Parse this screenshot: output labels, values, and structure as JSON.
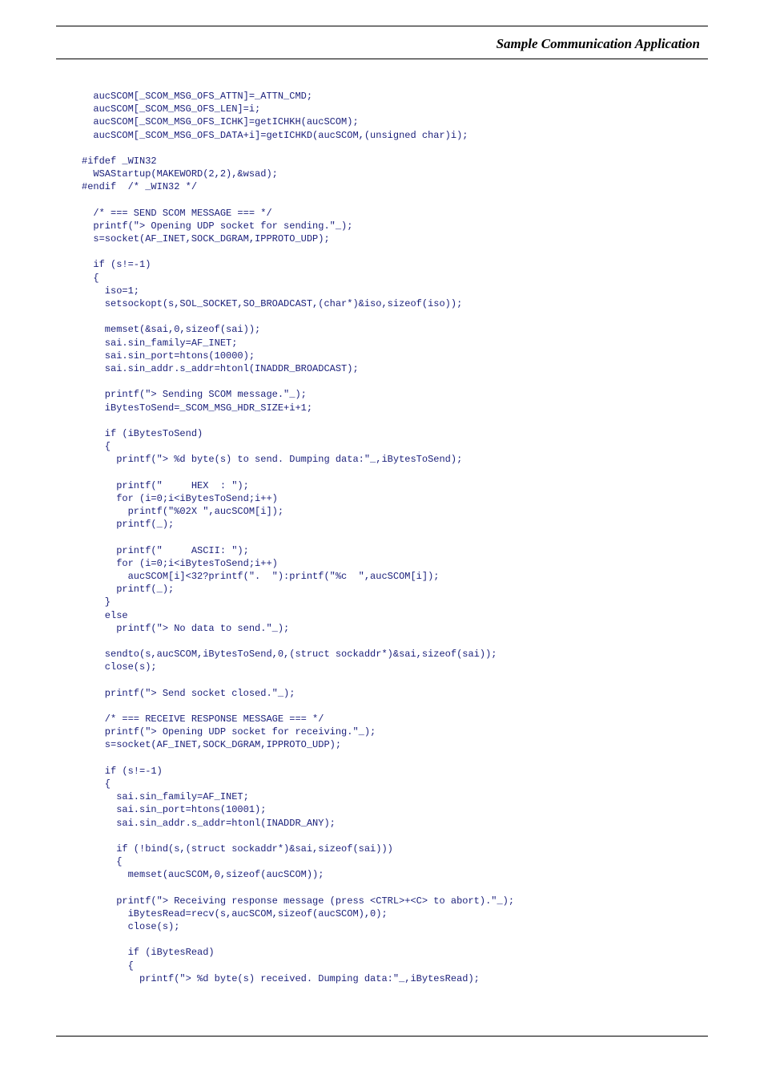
{
  "header": {
    "title": "Sample Communication Application"
  },
  "code_lines": [
    "  aucSCOM[_SCOM_MSG_OFS_ATTN]=_ATTN_CMD;",
    "  aucSCOM[_SCOM_MSG_OFS_LEN]=i;",
    "  aucSCOM[_SCOM_MSG_OFS_ICHK]=getICHKH(aucSCOM);",
    "  aucSCOM[_SCOM_MSG_OFS_DATA+i]=getICHKD(aucSCOM,(unsigned char)i);",
    "",
    "#ifdef _WIN32",
    "  WSAStartup(MAKEWORD(2,2),&wsad);",
    "#endif  /* _WIN32 */",
    "",
    "  /* === SEND SCOM MESSAGE === */",
    "  printf(\"> Opening UDP socket for sending.\"_);",
    "  s=socket(AF_INET,SOCK_DGRAM,IPPROTO_UDP);",
    "",
    "  if (s!=-1)",
    "  {",
    "    iso=1;",
    "    setsockopt(s,SOL_SOCKET,SO_BROADCAST,(char*)&iso,sizeof(iso));",
    "",
    "    memset(&sai,0,sizeof(sai));",
    "    sai.sin_family=AF_INET;",
    "    sai.sin_port=htons(10000);",
    "    sai.sin_addr.s_addr=htonl(INADDR_BROADCAST);",
    "",
    "    printf(\"> Sending SCOM message.\"_);",
    "    iBytesToSend=_SCOM_MSG_HDR_SIZE+i+1;",
    "",
    "    if (iBytesToSend)",
    "    {",
    "      printf(\"> %d byte(s) to send. Dumping data:\"_,iBytesToSend);",
    "",
    "      printf(\"     HEX  : \");",
    "      for (i=0;i<iBytesToSend;i++)",
    "        printf(\"%02X \",aucSCOM[i]);",
    "      printf(_);",
    "",
    "      printf(\"     ASCII: \");",
    "      for (i=0;i<iBytesToSend;i++)",
    "        aucSCOM[i]<32?printf(\".  \"):printf(\"%c  \",aucSCOM[i]);",
    "      printf(_);",
    "    }",
    "    else",
    "      printf(\"> No data to send.\"_);",
    "",
    "    sendto(s,aucSCOM,iBytesToSend,0,(struct sockaddr*)&sai,sizeof(sai));",
    "    close(s);",
    "",
    "    printf(\"> Send socket closed.\"_);",
    "",
    "    /* === RECEIVE RESPONSE MESSAGE === */",
    "    printf(\"> Opening UDP socket for receiving.\"_);",
    "    s=socket(AF_INET,SOCK_DGRAM,IPPROTO_UDP);",
    "",
    "    if (s!=-1)",
    "    {",
    "      sai.sin_family=AF_INET;",
    "      sai.sin_port=htons(10001);",
    "      sai.sin_addr.s_addr=htonl(INADDR_ANY);",
    "",
    "      if (!bind(s,(struct sockaddr*)&sai,sizeof(sai)))",
    "      {",
    "        memset(aucSCOM,0,sizeof(aucSCOM));",
    "",
    "      printf(\"> Receiving response message (press <CTRL>+<C> to abort).\"_);",
    "        iBytesRead=recv(s,aucSCOM,sizeof(aucSCOM),0);",
    "        close(s);",
    "",
    "        if (iBytesRead)",
    "        {",
    "          printf(\"> %d byte(s) received. Dumping data:\"_,iBytesRead);"
  ]
}
